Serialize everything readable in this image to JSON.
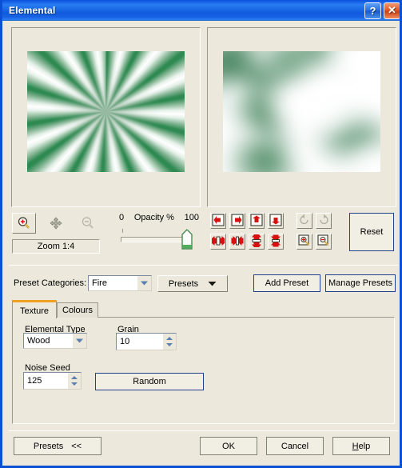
{
  "window": {
    "title": "Elemental",
    "help_button": "?",
    "close_button": "✕"
  },
  "preview": {
    "left_panel_name": "original-preview",
    "right_panel_name": "result-preview",
    "left_pattern": "green-starburst-rays",
    "right_pattern": "soft-green-wood-grain",
    "colors": {
      "accent_green": "#2f8a52",
      "light_green": "#94b8a0",
      "white": "#ffffff"
    }
  },
  "toolbar": {
    "zoom_in_tooltip": "Zoom In",
    "pan_tooltip": "Pan",
    "zoom_out_tooltip": "Zoom Out",
    "zoom_level": "Zoom 1:4",
    "opacity_min": "0",
    "opacity_caption": "Opacity %",
    "opacity_max": "100",
    "opacity_value": 100,
    "reset_label": "Reset",
    "nav_buttons": [
      "scroll-left",
      "scroll-right",
      "scroll-up",
      "scroll-down",
      "shrink-horizontal",
      "grow-horizontal",
      "shrink-vertical",
      "grow-vertical"
    ],
    "rotate_buttons": [
      "rotate-counterclockwise",
      "rotate-clockwise"
    ],
    "zoom_preset_buttons": [
      "zoom-region-in",
      "zoom-region-out"
    ]
  },
  "presets": {
    "categories_label": "Preset Categories:",
    "selected_category": "Fire",
    "presets_button": "Presets",
    "add_preset": "Add Preset",
    "manage_presets": "Manage Presets"
  },
  "tabs": [
    {
      "label": "Texture",
      "active": true
    },
    {
      "label": "Colours",
      "active": false
    }
  ],
  "texture_tab": {
    "elemental_type_label": "Elemental Type",
    "elemental_type_value": "Wood",
    "grain_label": "Grain",
    "grain_value": "10",
    "noise_seed_label": "Noise Seed",
    "noise_seed_value": "125",
    "random_button": "Random"
  },
  "footer": {
    "presets_toggle": "Presets",
    "presets_toggle_chevrons": "<<",
    "ok": "OK",
    "cancel": "Cancel",
    "help_prefix": "H",
    "help_suffix": "elp"
  },
  "theme": {
    "dialog_background": "#ece9dc",
    "title_blue": "#1868e6",
    "frame_blue": "#0a4fd4",
    "tab_accent_orange": "#f0a020",
    "focus_border": "#23408e"
  }
}
